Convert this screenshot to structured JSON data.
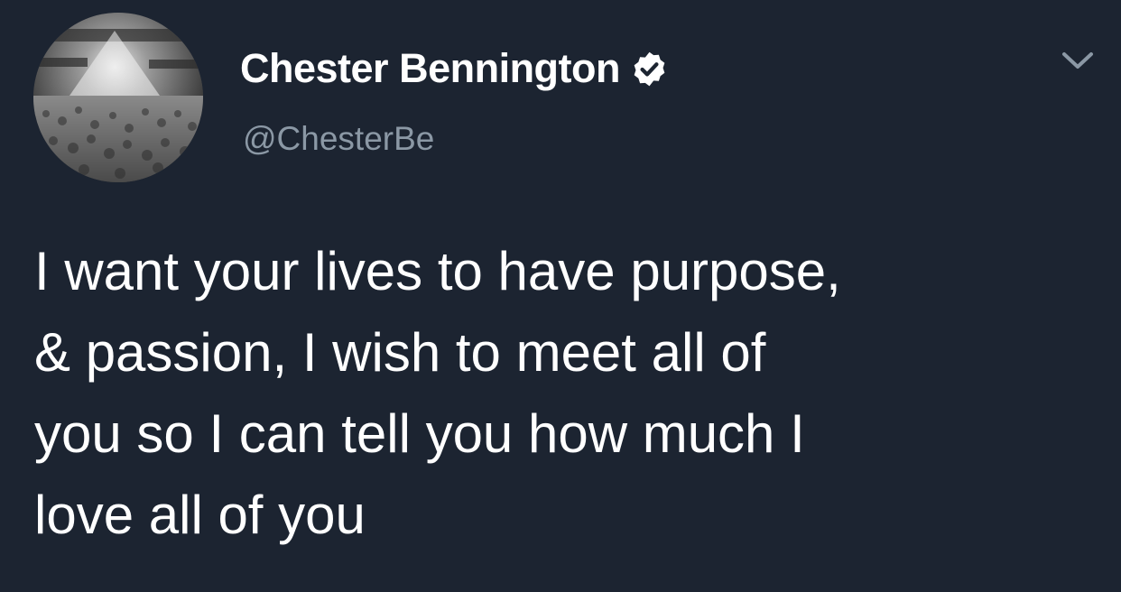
{
  "tweet": {
    "display_name": "Chester Bennington",
    "handle": "@ChesterBe",
    "text_lines": [
      "I want your lives to have purpose,",
      "& passion, I wish to meet all of",
      "you so I can tell you how much I",
      "love all of you"
    ]
  },
  "icons": {
    "verified": "verified-badge-icon",
    "more": "chevron-down-icon",
    "avatar": "concert-crowd-photo"
  },
  "colors": {
    "background": "#1c2431",
    "text": "#ffffff",
    "handle": "#8b98a5",
    "chevron": "#8b98a5"
  }
}
